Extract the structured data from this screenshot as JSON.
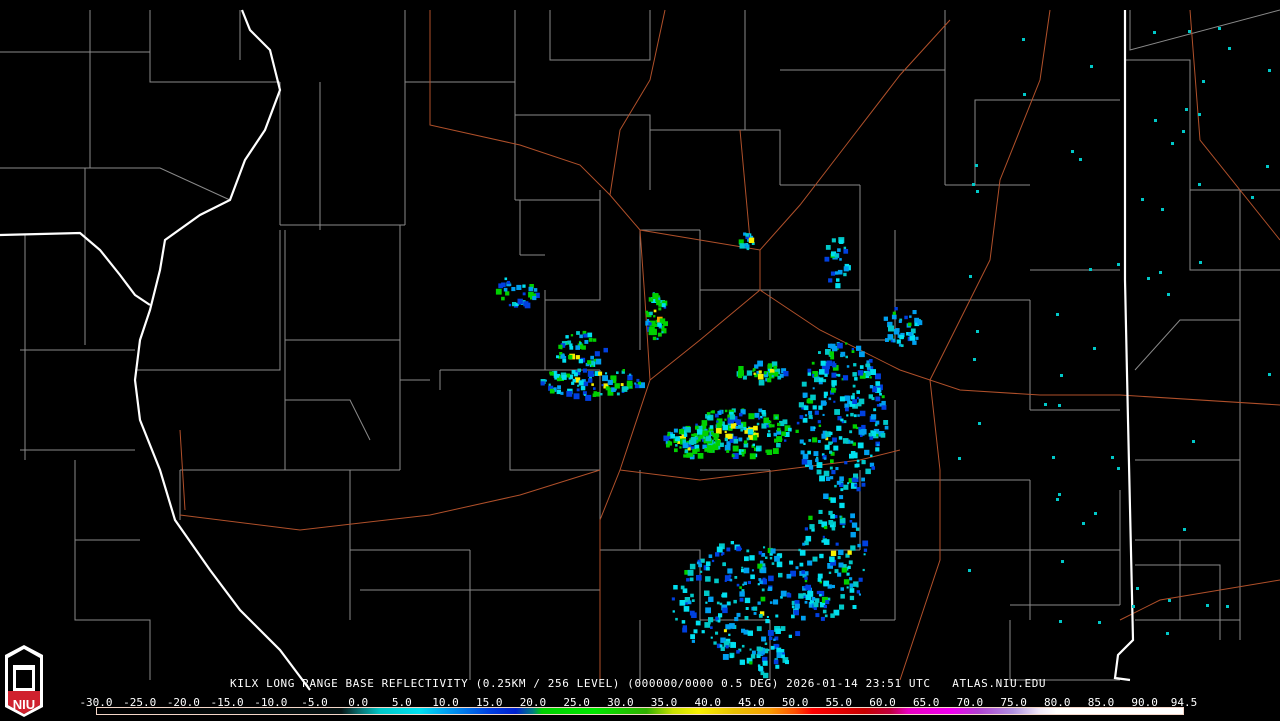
{
  "product": {
    "title": "KILX LONG RANGE BASE REFLECTIVITY (0.25KM / 256 LEVEL) (000000/0000 0.5 DEG) 2026-01-14 23:51 UTC   ATLAS.NIU.EDU",
    "station": "KILX",
    "datetime": "2026-01-14 23:51 UTC",
    "source": "ATLAS.NIU.EDU"
  },
  "logo": {
    "text": "NIU"
  },
  "colorbar": {
    "ticks": [
      "-30.0",
      "-25.0",
      "-20.0",
      "-15.0",
      "-10.0",
      "-5.0",
      "0.0",
      "5.0",
      "10.0",
      "15.0",
      "20.0",
      "25.0",
      "30.0",
      "35.0",
      "40.0",
      "45.0",
      "50.0",
      "55.0",
      "60.0",
      "65.0",
      "70.0",
      "75.0",
      "80.0",
      "85.0",
      "90.0",
      "94.5"
    ],
    "range": [
      -30,
      94.5
    ],
    "stops": [
      {
        "v": -30,
        "c": "#000000"
      },
      {
        "v": -2,
        "c": "#061414"
      },
      {
        "v": 0,
        "c": "#0a6e6e"
      },
      {
        "v": 2.5,
        "c": "#00c8c8"
      },
      {
        "v": 7,
        "c": "#00e0f0"
      },
      {
        "v": 10,
        "c": "#00a0f0"
      },
      {
        "v": 15,
        "c": "#0040e0"
      },
      {
        "v": 18,
        "c": "#0020d0"
      },
      {
        "v": 20,
        "c": "#008080"
      },
      {
        "v": 21,
        "c": "#00d000"
      },
      {
        "v": 27,
        "c": "#00e800"
      },
      {
        "v": 33,
        "c": "#30b000"
      },
      {
        "v": 36,
        "c": "#c8e000"
      },
      {
        "v": 39,
        "c": "#f8f000"
      },
      {
        "v": 43,
        "c": "#e8c000"
      },
      {
        "v": 47,
        "c": "#f8a000"
      },
      {
        "v": 50,
        "c": "#ff5000"
      },
      {
        "v": 52,
        "c": "#ff0000"
      },
      {
        "v": 58,
        "c": "#c80000"
      },
      {
        "v": 61,
        "c": "#c00040"
      },
      {
        "v": 63,
        "c": "#e800c0"
      },
      {
        "v": 68,
        "c": "#f000f0"
      },
      {
        "v": 71,
        "c": "#b040d0"
      },
      {
        "v": 75,
        "c": "#b090e0"
      },
      {
        "v": 78,
        "c": "#f0e8f8"
      },
      {
        "v": 80,
        "c": "#ffffff"
      },
      {
        "v": 94.5,
        "c": "#ffffff"
      }
    ]
  }
}
